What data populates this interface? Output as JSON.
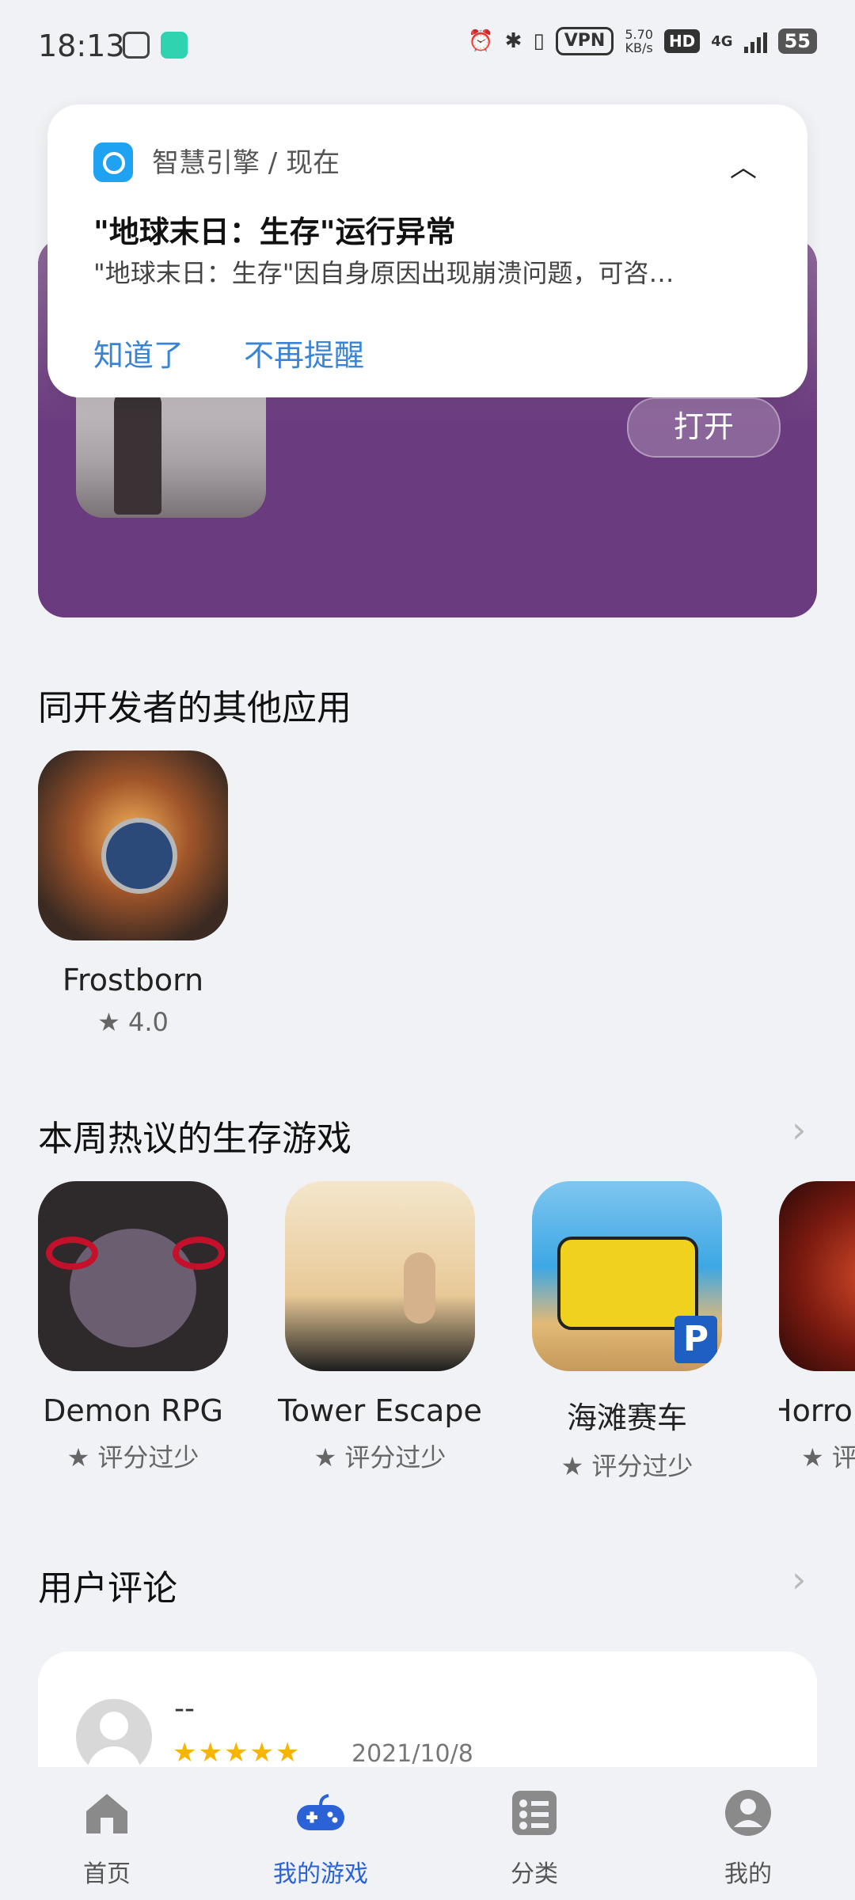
{
  "status_bar": {
    "time": "18:13",
    "vpn": "VPN",
    "speed_value": "5.70",
    "speed_unit": "KB/s",
    "hd": "HD",
    "network": "4G",
    "battery": "55"
  },
  "hero": {
    "open_label": "打开"
  },
  "notification": {
    "source": "智慧引擎 / 现在",
    "title": "\"地球末日：生存\"运行异常",
    "body": "\"地球末日：生存\"因自身原因出现崩溃问题，可咨…",
    "got_it_label": "知道了",
    "dont_remind_label": "不再提醒",
    "collapse_icon": "chevron-up-icon"
  },
  "same_developer": {
    "title": "同开发者的其他应用",
    "apps": [
      {
        "name": "Frostborn",
        "rating": "4.0"
      }
    ]
  },
  "hot_survival": {
    "title": "本周热议的生存游戏",
    "apps": [
      {
        "name": "Demon  RPG",
        "rating": "评分过少"
      },
      {
        "name": "Tower  Escape",
        "rating": "评分过少"
      },
      {
        "name": "海滩赛车",
        "rating": "评分过少"
      },
      {
        "name": "Horror",
        "rating": "评分过少"
      }
    ]
  },
  "reviews": {
    "title": "用户评论",
    "items": [
      {
        "user": "--",
        "stars": "★★★★★",
        "date": "2021/10/8"
      }
    ]
  },
  "bottom_nav": {
    "items": [
      {
        "label": "首页",
        "icon": "home-icon"
      },
      {
        "label": "我的游戏",
        "icon": "gamepad-icon"
      },
      {
        "label": "分类",
        "icon": "category-icon"
      },
      {
        "label": "我的",
        "icon": "profile-icon"
      }
    ]
  },
  "colors": {
    "accent": "#2b63d6",
    "banner": "#6b3b7f",
    "star": "#f7b500",
    "link": "#3a84d6"
  }
}
